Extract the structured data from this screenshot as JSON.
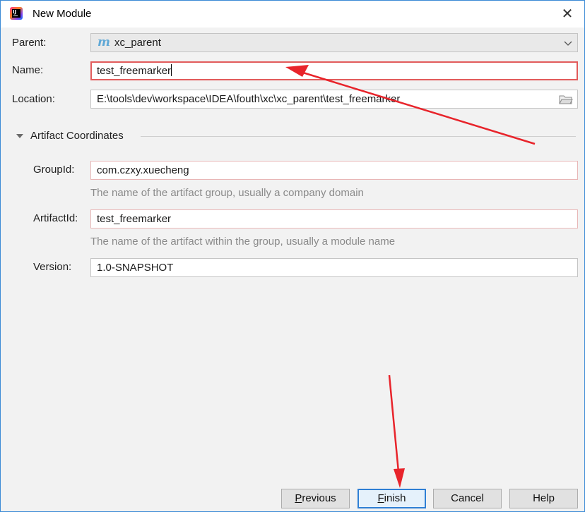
{
  "window": {
    "title": "New Module",
    "close_symbol": "✕"
  },
  "form": {
    "parent": {
      "label": "Parent:",
      "value": "xc_parent",
      "icon": "maven-icon",
      "icon_glyph": "m"
    },
    "name": {
      "label": "Name:",
      "value": "test_freemarker"
    },
    "location": {
      "label": "Location:",
      "value": "E:\\tools\\dev\\workspace\\IDEA\\fouth\\xc\\xc_parent\\test_freemarker"
    }
  },
  "artifact": {
    "section_title": "Artifact Coordinates",
    "group_id": {
      "label": "GroupId:",
      "value": "com.czxy.xuecheng",
      "hint": "The name of the artifact group, usually a company domain"
    },
    "artifact_id": {
      "label": "ArtifactId:",
      "value": "test_freemarker",
      "hint": "The name of the artifact within the group, usually a module name"
    },
    "version": {
      "label": "Version:",
      "value": "1.0-SNAPSHOT"
    }
  },
  "buttons": {
    "previous": {
      "mnemonic": "P",
      "rest": "revious"
    },
    "finish": {
      "mnemonic": "F",
      "rest": "inish"
    },
    "cancel": "Cancel",
    "help": "Help"
  },
  "colors": {
    "window_border": "#3c8ad6",
    "annotation_arrow": "#e8242b",
    "maven_icon": "#5fa8d6",
    "default_button_border": "#2f7fd4",
    "error_field_border": "#e25b5b"
  }
}
